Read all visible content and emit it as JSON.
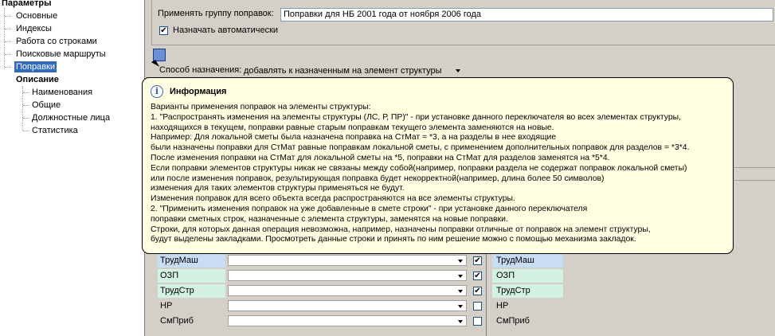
{
  "tree": {
    "root": "Параметры",
    "items": [
      "Основные",
      "Индексы",
      "Работа со строками",
      "Поисковые маршруты",
      "Поправки"
    ],
    "selected_index": 4,
    "section": "Описание",
    "sub_items": [
      "Наименования",
      "Общие",
      "Должностные лица",
      "Статистика"
    ]
  },
  "form": {
    "group_label": "Применять группу поправок:",
    "group_value": "Поправки для НБ 2001 года от ноября 2006 года",
    "auto_assign_label": "Назначать автоматически",
    "auto_assign_checked": true,
    "method_label": "Способ назначения:",
    "method_value": "добавлять к назначенным на элемент структуры"
  },
  "popup": {
    "title": "Информация",
    "lines": [
      "Варианты применения поправок на элементы структуры:",
      "1. \"Распространять изменения на элементы структуры (ЛС, Р, ПР)\" -  при установке данного переключателя во всех элементах структуры,",
      "находящихся в текущем, поправки равные старым поправкам текущего элемента заменяются на новые.",
      "Например: Для локальной сметы была назначена поправка на СтМат = *3, а на разделы в нее входящие",
      "были назначены поправки для СтМат равные поправкам локальной сметы, с применением дополнительных поправок для разделов = *3*4.",
      "После изменения поправки на СтМат для локальной сметы на *5, поправки на СтМат для разделов заменятся на *5*4.",
      "Если поправки элементов структуры никак не связаны между собой(например, поправки раздела не содержат поправок локальной сметы)",
      "или после изменения поправок, результирующая поправка будет некорректной(например, длина более 50 символов)",
      "изменения для таких элементов структуры применяться не будут.",
      "Изменения поправок для всего объекта всегда распространяются на все элементы структуры.",
      "2. \"Применить изменения поправок на уже добавленные в смете строки\" - при  установке данного переключателя",
      "поправки сметных строк, назначенные с элемента структуры, заменятся на новые поправки.",
      "Строки, для которых данная операция невозможна, например, назначены поправки отличные от поправок на элемент структуры,",
      "будут выделены закладками. Просмотреть данные строки и принять по ним решение можно с помощью механизма закладок."
    ]
  },
  "grid_left": [
    {
      "name": "ТрудМаш",
      "checked": true
    },
    {
      "name": "ОЗП",
      "checked": true
    },
    {
      "name": "ТрудСтр",
      "checked": true
    },
    {
      "name": "НР",
      "checked": false
    },
    {
      "name": "СмПриб",
      "checked": false
    }
  ],
  "grid_right": [
    "ТрудМаш",
    "ОЗП",
    "ТрудСтр",
    "НР",
    "СмПриб"
  ],
  "colors": {
    "selection": "#316ac5",
    "tooltip_bg": "#ffffe1",
    "row_blue": "#c7dcf5",
    "row_green": "#d4f2e4"
  },
  "icons": [
    "info-icon",
    "check-icon",
    "dropdown-arrow-icon",
    "corrections-button-icon"
  ]
}
